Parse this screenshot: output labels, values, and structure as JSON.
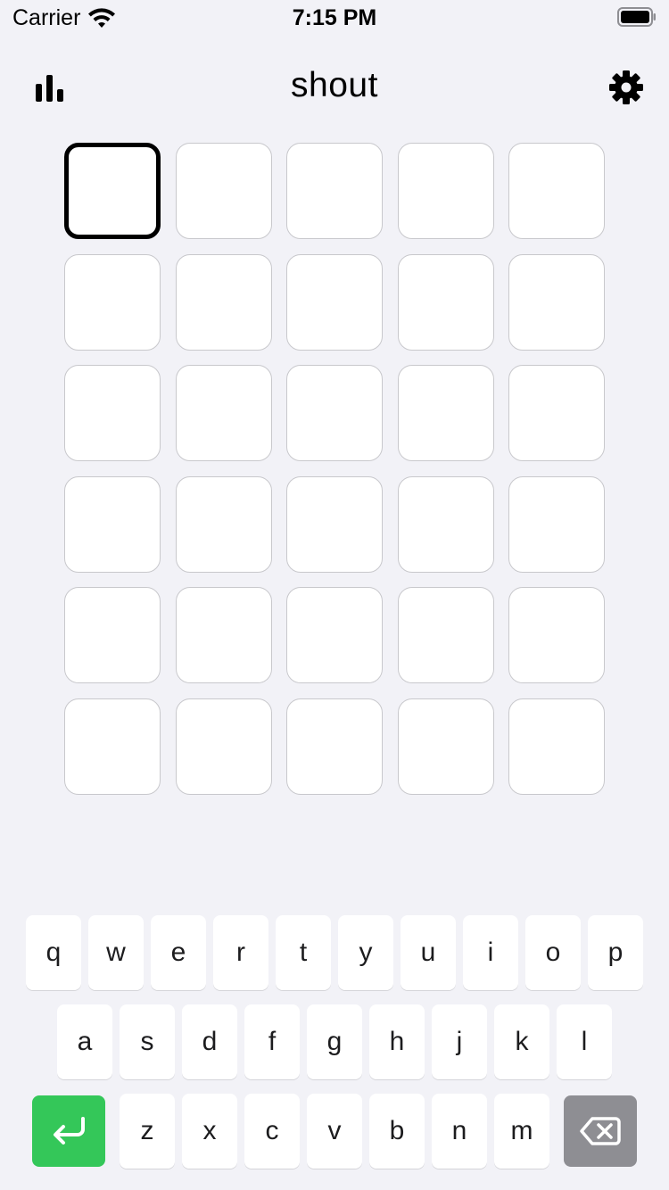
{
  "status_bar": {
    "carrier": "Carrier",
    "time": "7:15 PM"
  },
  "header": {
    "title": "shout",
    "left_icon": "bar-chart-icon",
    "right_icon": "gear-icon"
  },
  "board": {
    "rows": 6,
    "columns": 5,
    "active_tile": [
      0,
      0
    ],
    "letters": [
      [
        "",
        "",
        "",
        "",
        ""
      ],
      [
        "",
        "",
        "",
        "",
        ""
      ],
      [
        "",
        "",
        "",
        "",
        ""
      ],
      [
        "",
        "",
        "",
        "",
        ""
      ],
      [
        "",
        "",
        "",
        "",
        ""
      ],
      [
        "",
        "",
        "",
        "",
        ""
      ]
    ]
  },
  "keyboard": {
    "rows": [
      [
        "q",
        "w",
        "e",
        "r",
        "t",
        "y",
        "u",
        "i",
        "o",
        "p"
      ],
      [
        "a",
        "s",
        "d",
        "f",
        "g",
        "h",
        "j",
        "k",
        "l"
      ],
      [
        "z",
        "x",
        "c",
        "v",
        "b",
        "n",
        "m"
      ]
    ],
    "enter_icon": "return-arrow-icon",
    "backspace_icon": "backspace-icon"
  },
  "colors": {
    "background": "#f2f2f7",
    "enter_key": "#34c759",
    "backspace_key": "#8e8e93",
    "tile_border": "#c8c8cc",
    "active_tile_border": "#000000"
  }
}
